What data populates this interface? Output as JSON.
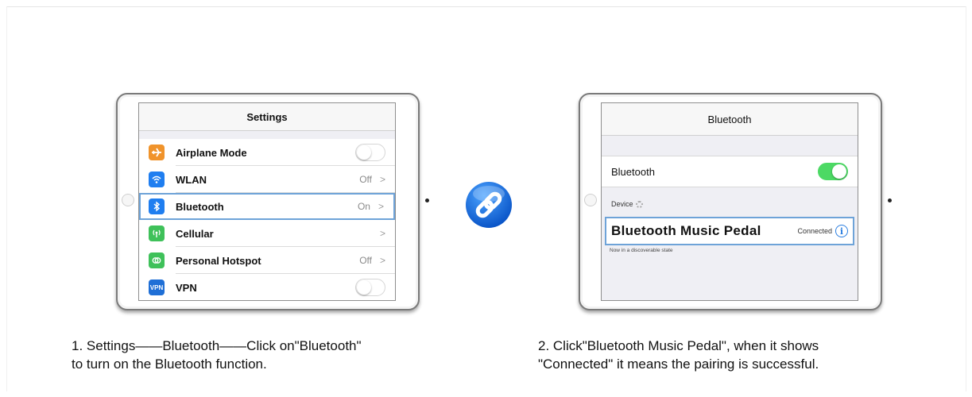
{
  "left_panel": {
    "title": "Settings",
    "items": [
      {
        "label": "Airplane Mode",
        "icon": "airplane-icon",
        "icon_color": "#f0932b",
        "control": "toggle-off",
        "value": "",
        "chevron": ""
      },
      {
        "label": "WLAN",
        "icon": "wifi-icon",
        "icon_color": "#1f7ef0",
        "control": "value",
        "value": "Off",
        "chevron": ">"
      },
      {
        "label": "Bluetooth",
        "icon": "bluetooth-icon",
        "icon_color": "#1f7ef0",
        "control": "value",
        "value": "On",
        "chevron": ">",
        "selected": true
      },
      {
        "label": "Cellular",
        "icon": "cellular-icon",
        "icon_color": "#3fc15a",
        "control": "value",
        "value": "",
        "chevron": ">"
      },
      {
        "label": "Personal Hotspot",
        "icon": "hotspot-icon",
        "icon_color": "#3fc15a",
        "control": "value",
        "value": "Off",
        "chevron": ">"
      },
      {
        "label": "VPN",
        "icon": "vpn-icon",
        "icon_text": "VPN",
        "icon_color": "#1f6fd6",
        "control": "toggle-off",
        "value": "",
        "chevron": ""
      }
    ]
  },
  "right_panel": {
    "title": "Bluetooth",
    "bluetooth_label": "Bluetooth",
    "bluetooth_toggle": "on",
    "devices_header": "Device",
    "device_name": "Bluetooth Music Pedal",
    "device_status": "Connected",
    "info_glyph": "i",
    "discoverable_text": "Now in a discoverable state"
  },
  "link_icon": {
    "icon": "link-icon",
    "color": "#1d6fe0"
  },
  "captions": {
    "left_line1": "1. Settings——Bluetooth——Click on\"Bluetooth\"",
    "left_line2": "to turn on the Bluetooth function.",
    "right_line1": "2. Click\"Bluetooth Music Pedal\", when it shows",
    "right_line2": "\"Connected\" it means the pairing is successful."
  },
  "colors": {
    "highlight": "#6ea3d8",
    "toggle_on": "#4cd964"
  }
}
